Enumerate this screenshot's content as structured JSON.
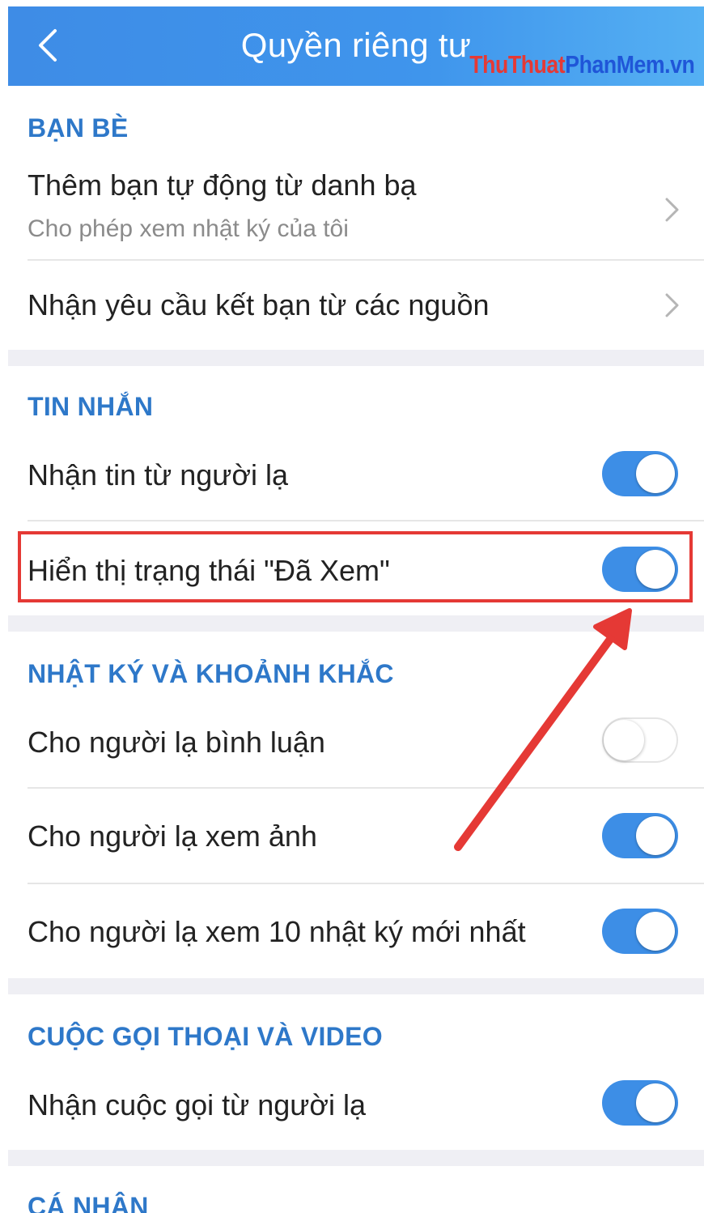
{
  "header": {
    "title": "Quyền riêng tư",
    "back_icon": "chevron-left-icon",
    "watermark_part1": "ThuThuat",
    "watermark_part2": "PhanMem.vn"
  },
  "colors": {
    "accent": "#3d8ee6",
    "section": "#2e78c9",
    "highlight": "#e53935"
  },
  "sections": {
    "friends": {
      "title": "BẠN BÈ",
      "items": [
        {
          "label": "Thêm bạn tự động từ danh bạ",
          "sublabel": "Cho phép xem nhật ký của tôi",
          "control": "chevron"
        },
        {
          "label": "Nhận yêu cầu kết bạn từ các nguồn",
          "control": "chevron"
        }
      ]
    },
    "messages": {
      "title": "TIN NHẮN",
      "items": [
        {
          "label": "Nhận tin từ người lạ",
          "toggle": true
        },
        {
          "label": "Hiển thị trạng thái \"Đã Xem\"",
          "toggle": true
        }
      ]
    },
    "diary": {
      "title": "NHẬT KÝ VÀ KHOẢNH KHẮC",
      "items": [
        {
          "label": "Cho người lạ bình luận",
          "toggle": false
        },
        {
          "label": "Cho người lạ xem ảnh",
          "toggle": true
        },
        {
          "label": "Cho người lạ xem 10 nhật ký mới nhất",
          "toggle": true
        }
      ]
    },
    "calls": {
      "title": "CUỘC GỌI THOẠI VÀ VIDEO",
      "items": [
        {
          "label": "Nhận cuộc gọi từ người lạ",
          "toggle": true
        }
      ]
    },
    "personal": {
      "title": "CÁ NHÂN"
    }
  }
}
